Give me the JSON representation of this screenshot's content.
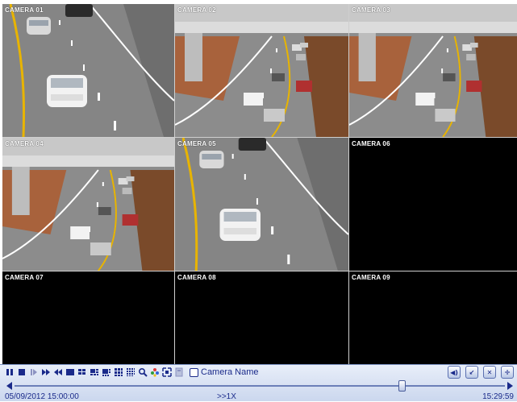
{
  "cameras": [
    {
      "label": "CAMERA 01",
      "feed": "closeup"
    },
    {
      "label": "CAMERA 02",
      "feed": "overpass"
    },
    {
      "label": "CAMERA 03",
      "feed": "overpass"
    },
    {
      "label": "CAMERA 04",
      "feed": "overpass"
    },
    {
      "label": "CAMERA 05",
      "feed": "closeup"
    },
    {
      "label": "CAMERA 06",
      "feed": "none"
    },
    {
      "label": "CAMERA 07",
      "feed": "none"
    },
    {
      "label": "CAMERA 08",
      "feed": "none"
    },
    {
      "label": "CAMERA 09",
      "feed": "none"
    }
  ],
  "toolbar": {
    "camera_name_label": "Camera Name",
    "icons": [
      "pause-icon",
      "stop-icon",
      "step-forward-icon",
      "fast-forward-icon",
      "rewind-icon",
      "layout-1-icon",
      "layout-4-icon",
      "layout-6-icon",
      "layout-8-icon",
      "layout-9-icon",
      "layout-16-icon",
      "zoom-icon",
      "color-icon",
      "snapshot-icon",
      "backup-icon",
      "volume-icon",
      "exit-icon",
      "close-icon",
      "fullscreen-icon"
    ]
  },
  "playback": {
    "position_fraction": 0.79
  },
  "status": {
    "start_time": "05/09/2012 15:00:00",
    "speed": ">>1X",
    "current_time": "15:29:59"
  },
  "colors": {
    "accent": "#1a2a8a",
    "panel": "#cbd7ee",
    "road": "#7c7c7c",
    "lane_yellow": "#e8b400"
  }
}
